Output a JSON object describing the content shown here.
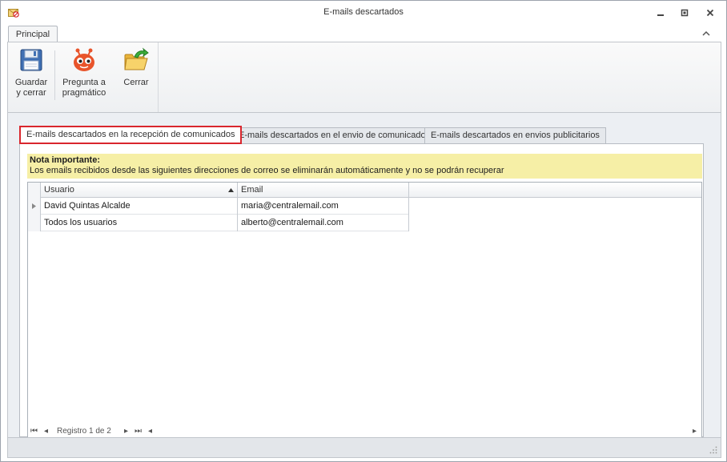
{
  "window": {
    "title": "E-mails descartados",
    "icon": "envelope-no-icon"
  },
  "ribbon": {
    "tab_label": "Principal",
    "buttons": [
      {
        "line1": "Guardar",
        "line2": "y cerrar",
        "icon": "floppy-disk-icon"
      },
      {
        "line1": "Pregunta a",
        "line2": "pragmático",
        "icon": "robot-face-icon"
      },
      {
        "line1": "Cerrar",
        "line2": "",
        "icon": "folder-exit-icon"
      }
    ]
  },
  "tabs": [
    {
      "label": "E-mails descartados en la recepción de comunicados",
      "active": true
    },
    {
      "label": "E-mails descartados en el envio de comunicado",
      "active": false
    },
    {
      "label": "E-mails descartados en envios publicitarios",
      "active": false
    }
  ],
  "note": {
    "heading": "Nota importante:",
    "text": "Los emails recibidos desde las siguientes direcciones de correo se eliminarán automáticamente y no se podrán recuperar"
  },
  "grid": {
    "columns": [
      "Usuario",
      "Email"
    ],
    "rows": [
      {
        "usuario": "David Quintas Alcalde",
        "email": "maria@centralemail.com"
      },
      {
        "usuario": "Todos los usuarios",
        "email": "alberto@centralemail.com"
      }
    ],
    "pager_text": "Registro 1 de 2"
  },
  "colors": {
    "active_tab_border": "#d9262d",
    "note_background": "#f6efa6"
  }
}
